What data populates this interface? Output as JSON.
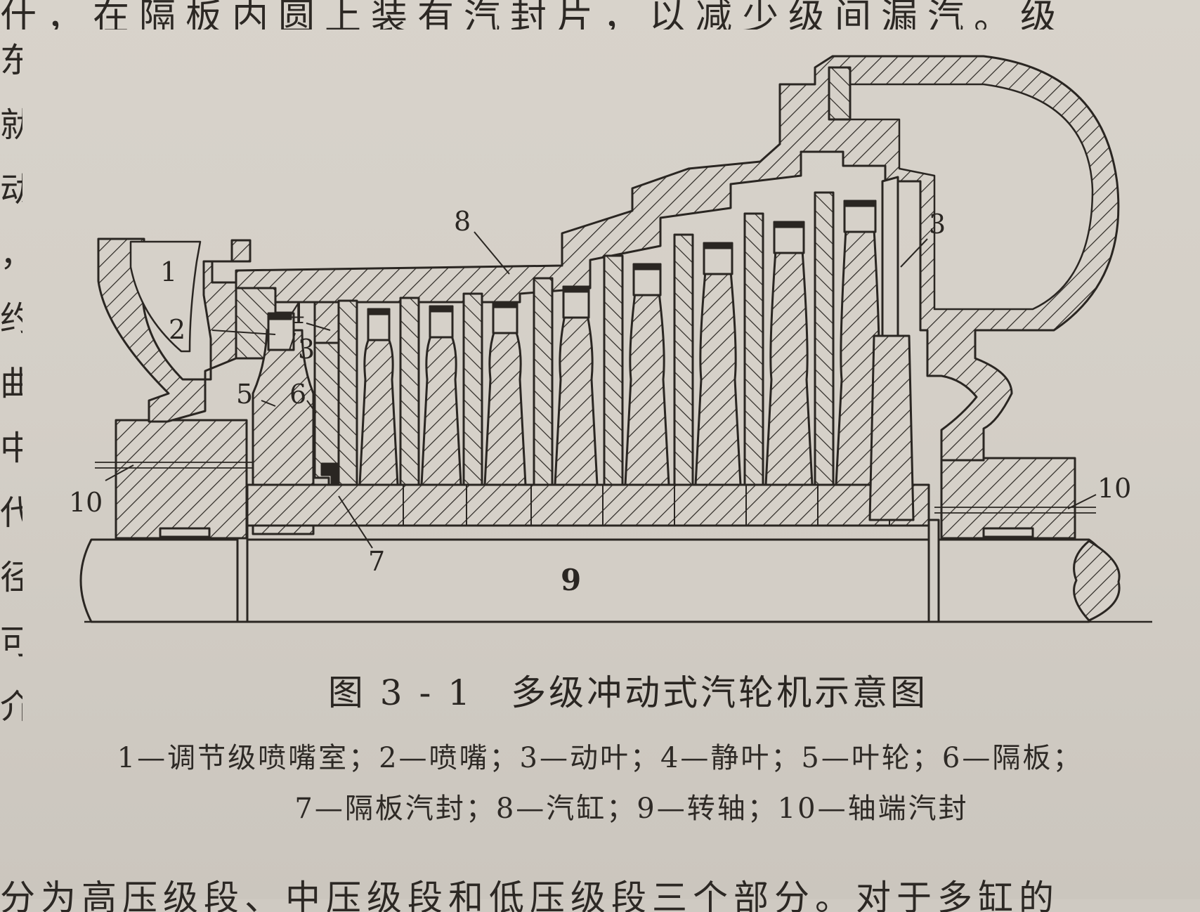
{
  "figure": {
    "caption": "图 3 - 1　多级冲动式汽轮机示意图",
    "legend_line_1": "1—调节级喷嘴室；2—喷嘴；3—动叶；4—静叶；5—叶轮；6—隔板；",
    "legend_line_2": "7—隔板汽封；8—汽缸；9—转轴；10—轴端汽封",
    "part_labels": {
      "l1": "1",
      "l2": "2",
      "l3a": "3",
      "l3b": "3",
      "l4": "4",
      "l5": "5",
      "l6": "6",
      "l7": "7",
      "l8": "8",
      "l9": "9",
      "l10a": "10",
      "l10b": "10"
    }
  },
  "page_text": {
    "top_fragment": "什，在隔板内圆上装有汽封片，以减少级间漏汽。级",
    "left_column": [
      "东",
      "就",
      "动",
      "，",
      "约",
      "曲",
      "中",
      "代",
      "径",
      "可",
      "介"
    ],
    "bottom_fragment": "分为高压级段、中压级段和低压级段三个部分。对于多缸的"
  },
  "colors": {
    "ink": "#2a2622",
    "paper": "#d4cfc7"
  }
}
